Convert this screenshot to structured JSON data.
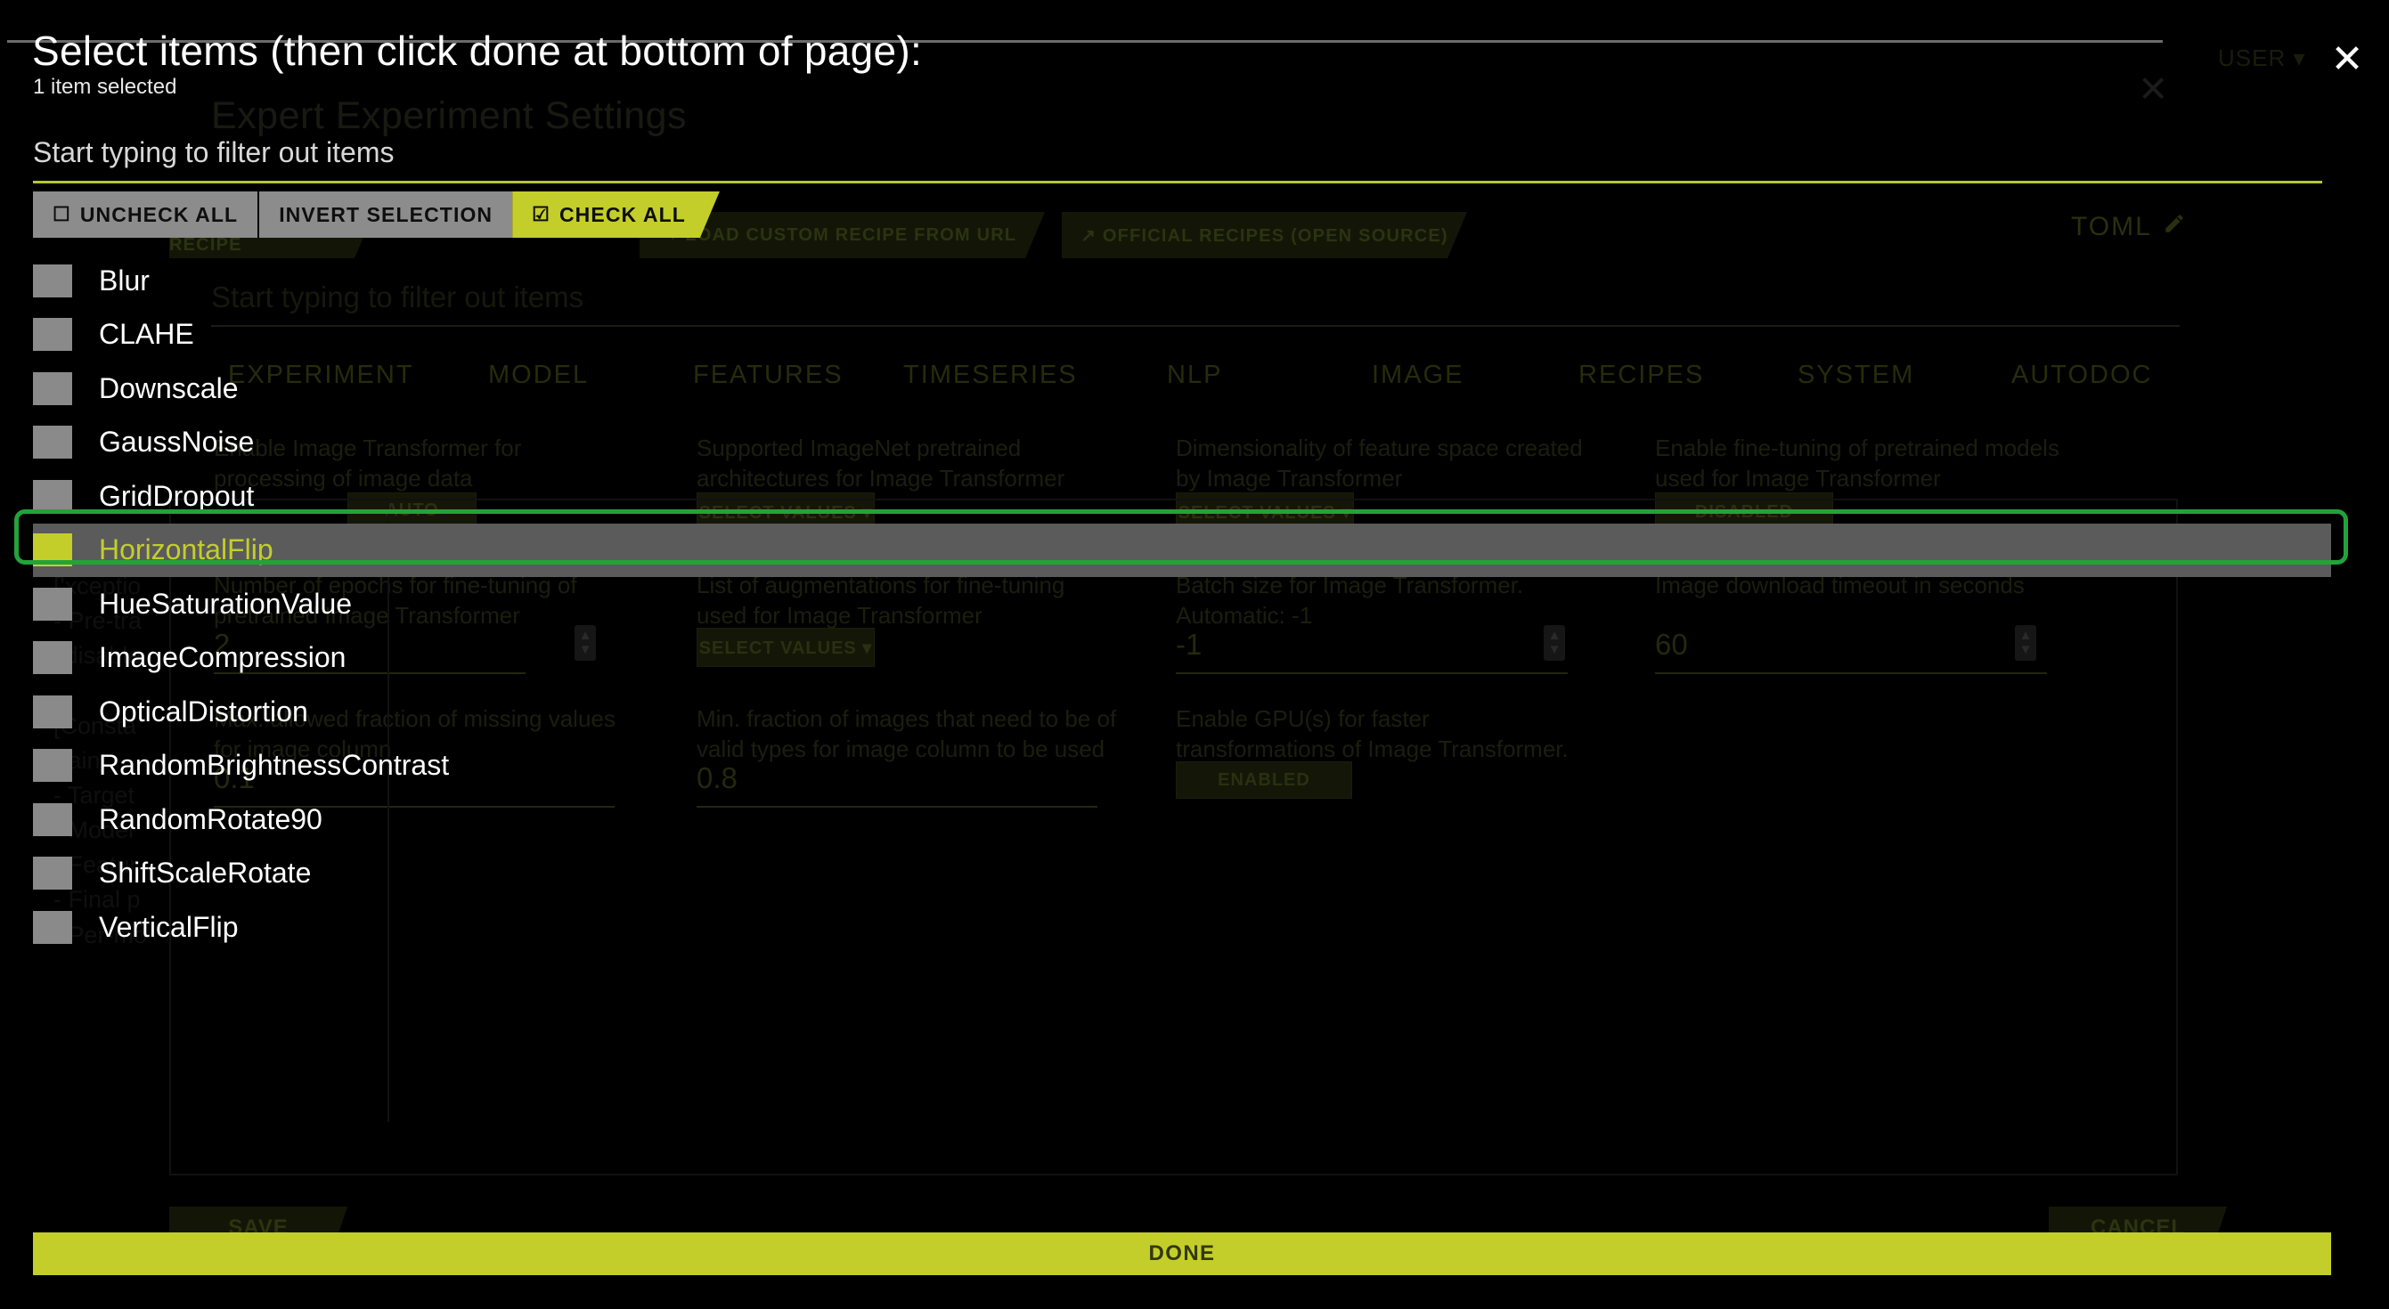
{
  "modal": {
    "title": "Select items (then click done at bottom of page):",
    "subtitle": "1 item selected",
    "filter_label": "Start typing to filter out items",
    "close_icon": "✕",
    "done_label": "DONE",
    "accent_color": "#c3ce2a",
    "focus_ring_color": "#22a33a",
    "buttons": [
      {
        "label": "UNCHECK ALL",
        "glyph": "☐",
        "style": "secondary"
      },
      {
        "label": "INVERT SELECTION",
        "glyph": "",
        "style": "secondary"
      },
      {
        "label": "CHECK ALL",
        "glyph": "☑",
        "style": "primary"
      }
    ],
    "items": [
      {
        "label": "Blur",
        "checked": false
      },
      {
        "label": "CLAHE",
        "checked": false
      },
      {
        "label": "Downscale",
        "checked": false
      },
      {
        "label": "GaussNoise",
        "checked": false
      },
      {
        "label": "GridDropout",
        "checked": false
      },
      {
        "label": "HorizontalFlip",
        "checked": true
      },
      {
        "label": "HueSaturationValue",
        "checked": false
      },
      {
        "label": "ImageCompression",
        "checked": false
      },
      {
        "label": "OpticalDistortion",
        "checked": false
      },
      {
        "label": "RandomBrightnessContrast",
        "checked": false
      },
      {
        "label": "RandomRotate90",
        "checked": false
      },
      {
        "label": "ShiftScaleRotate",
        "checked": false
      },
      {
        "label": "VerticalFlip",
        "checked": false
      }
    ]
  },
  "background": {
    "page_title": "Expert Experiment Settings",
    "close_icon": "✕",
    "user_menu": "USER ▾",
    "filter_label": "Start typing to filter out items",
    "toml_label": "TOML",
    "tabs": [
      "EXPERIMENT",
      "MODEL",
      "FEATURES",
      "TIMESERIES",
      "NLP",
      "IMAGE",
      "RECIPES",
      "SYSTEM",
      "AUTODOC"
    ],
    "chips": [
      "+ UPLOAD CUSTOM RECIPE",
      "+ LOAD CUSTOM RECIPE FROM URL",
      "↗ OFFICIAL RECIPES (OPEN SOURCE)"
    ],
    "settings": [
      {
        "desc": "Enable Image Transformer for processing of image data",
        "control_kind": "toggle",
        "value": "AUTO"
      },
      {
        "desc": "Supported ImageNet pretrained architectures for Image Transformer",
        "control_kind": "select",
        "value": "SELECT VALUES ▾"
      },
      {
        "desc": "Dimensionality of feature space created by Image Transformer",
        "control_kind": "select",
        "value": "SELECT VALUES ▾"
      },
      {
        "desc": "Enable fine-tuning of pretrained models used for Image Transformer",
        "control_kind": "toggle",
        "value": "DISABLED"
      },
      {
        "desc": "Number of epochs for fine-tuning of pretrained Image Transformer",
        "control_kind": "number",
        "value": "2"
      },
      {
        "desc": "List of augmentations for fine-tuning used for Image Transformer",
        "control_kind": "select",
        "value": "SELECT VALUES ▾"
      },
      {
        "desc": "Batch size for Image Transformer. Automatic: -1",
        "control_kind": "number",
        "value": "-1"
      },
      {
        "desc": "Image download timeout in seconds",
        "control_kind": "number",
        "value": "60"
      },
      {
        "desc": "Max. allowed fraction of missing values for image column",
        "control_kind": "number",
        "value": "0.1"
      },
      {
        "desc": "Min. fraction of images that need to be of valid types for image column to be used",
        "control_kind": "number",
        "value": "0.8"
      },
      {
        "desc": "Enable GPU(s) for faster transformations of Image Transformer.",
        "control_kind": "toggle",
        "value": "ENABLED"
      }
    ],
    "left_code": "- Pre-tra\n['xceptio\n- Pre-tra\n['disable\n\n[Consta\ntrain:\n- Target\n- Model\n- Featur\n- Final p\n- Per-mo",
    "save_label": "SAVE",
    "cancel_label": "CANCEL"
  }
}
